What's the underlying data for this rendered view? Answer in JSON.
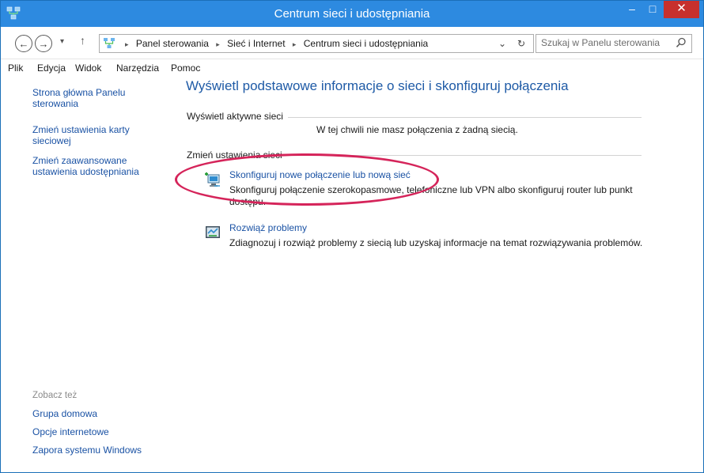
{
  "window": {
    "title": "Centrum sieci i udostępniania",
    "minimize": "–",
    "maximize": "□",
    "close": "✕",
    "accent": "#2d8ae0",
    "close_color": "#c7302d"
  },
  "address": {
    "back": "←",
    "forward": "→",
    "recent": "▾",
    "up": "↑",
    "crumbs": [
      "Panel sterowania",
      "Sieć i Internet",
      "Centrum sieci i udostępniania"
    ],
    "separator": "▸",
    "dropdown": "⌄",
    "refresh": "↻",
    "search_placeholder": "Szukaj w Panelu sterowania"
  },
  "menu": [
    {
      "label": "Plik"
    },
    {
      "label": "Edycja"
    },
    {
      "label": "Widok"
    },
    {
      "label": "Narzędzia"
    },
    {
      "label": "Pomoc"
    }
  ],
  "sidebar": {
    "links": [
      "Strona główna Panelu sterowania",
      "Zmień ustawienia karty sieciowej",
      "Zmień zaawansowane ustawienia udostępniania"
    ],
    "see_also_heading": "Zobacz też",
    "see_also": [
      "Grupa domowa",
      "Opcje internetowe",
      "Zapora systemu Windows"
    ]
  },
  "main": {
    "title": "Wyświetl podstawowe informacje o sieci i skonfiguruj połączenia",
    "active_networks_label": "Wyświetl aktywne sieci",
    "no_connection": "W tej chwili nie masz połączenia z żadną siecią.",
    "change_settings_label": "Zmień ustawienia sieci",
    "tasks": [
      {
        "icon": "network-setup-icon",
        "link": "Skonfiguruj nowe połączenie lub nową sieć",
        "description": "Skonfiguruj połączenie szerokopasmowe, telefoniczne lub VPN albo skonfiguruj router lub punkt dostępu."
      },
      {
        "icon": "troubleshoot-icon",
        "link": "Rozwiąż problemy",
        "description": "Zdiagnozuj i rozwiąż problemy z siecią lub uzyskaj informacje na temat rozwiązywania problemów."
      }
    ]
  },
  "annotation": {
    "highlight_color": "#d5245a"
  }
}
